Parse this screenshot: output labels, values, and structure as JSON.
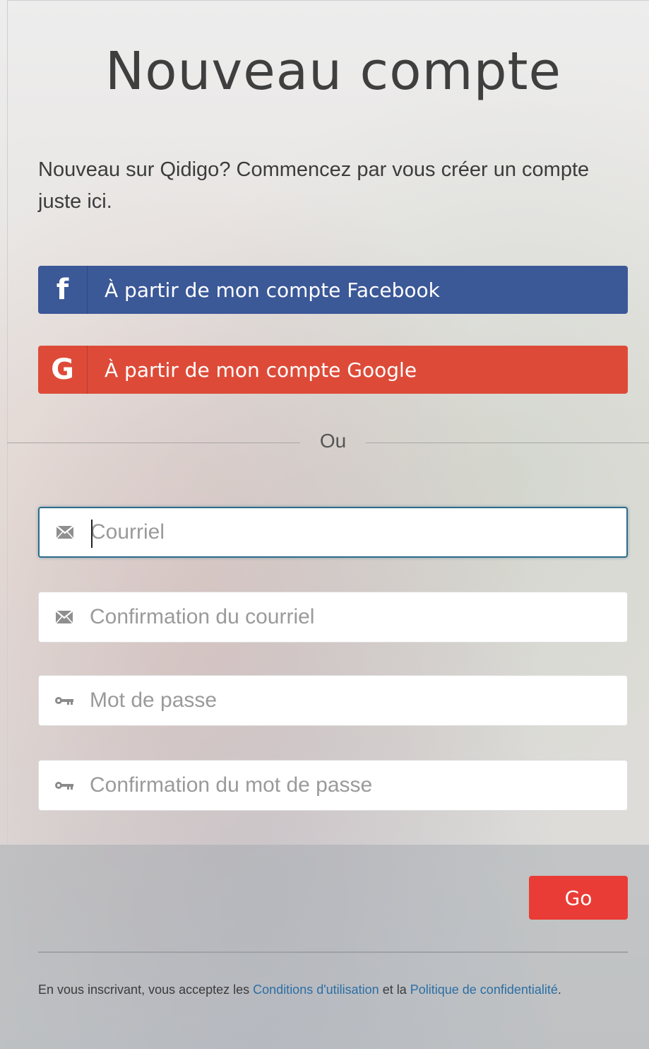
{
  "form": {
    "title": "Nouveau compte",
    "intro": "Nouveau sur Qidigo? Commencez par vous créer un compte juste ici.",
    "facebook_label": "À partir de mon compte Facebook",
    "google_label": "À partir de mon compte Google",
    "divider_text": "Ou",
    "fields": [
      {
        "placeholder": "Courriel",
        "value": "",
        "icon": "envelope-icon",
        "focused": true
      },
      {
        "placeholder": "Confirmation du courriel",
        "value": "",
        "icon": "envelope-icon"
      },
      {
        "placeholder": "Mot de passe",
        "value": "",
        "icon": "key-icon"
      },
      {
        "placeholder": "Confirmation du mot de passe",
        "value": "",
        "icon": "key-icon"
      }
    ],
    "submit_label": "Go"
  },
  "terms": {
    "prefix": "En vous inscrivant, vous acceptez les ",
    "conditions_link": "Conditions d'utilisation",
    "middle": " et la ",
    "privacy_link": "Politique de confidentialité",
    "suffix": "."
  },
  "colors": {
    "facebook": "#3b5897",
    "google": "#dd4b38",
    "submit": "#e93c36",
    "link": "#2c6ea3",
    "focus_border": "#2e6c8a"
  }
}
